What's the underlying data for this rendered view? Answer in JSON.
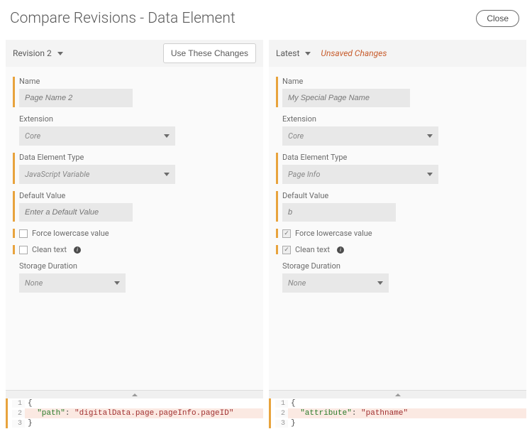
{
  "header": {
    "title": "Compare Revisions - Data Element",
    "close_label": "Close"
  },
  "left": {
    "revision_label": "Revision 2",
    "use_label": "Use These Changes",
    "fields": {
      "name_label": "Name",
      "name_value": "Page Name 2",
      "extension_label": "Extension",
      "extension_value": "Core",
      "type_label": "Data Element Type",
      "type_value": "JavaScript Variable",
      "default_label": "Default Value",
      "default_value": "Enter a Default Value",
      "force_lower_label": "Force lowercase value",
      "force_lower_checked": false,
      "clean_text_label": "Clean text",
      "clean_text_checked": false,
      "storage_label": "Storage Duration",
      "storage_value": "None"
    },
    "code": {
      "line1_open": "{",
      "line2_key": "\"path\"",
      "line2_sep": ": ",
      "line2_val": "\"digitalData.page.pageInfo.pageID\"",
      "line3_close": "}"
    }
  },
  "right": {
    "revision_label": "Latest",
    "unsaved_label": "Unsaved Changes",
    "fields": {
      "name_label": "Name",
      "name_value": "My Special Page Name",
      "extension_label": "Extension",
      "extension_value": "Core",
      "type_label": "Data Element Type",
      "type_value": "Page Info",
      "default_label": "Default Value",
      "default_value": "b",
      "force_lower_label": "Force lowercase value",
      "force_lower_checked": true,
      "clean_text_label": "Clean text",
      "clean_text_checked": true,
      "storage_label": "Storage Duration",
      "storage_value": "None"
    },
    "code": {
      "line1_open": "{",
      "line2_key": "\"attribute\"",
      "line2_sep": ": ",
      "line2_val": "\"pathname\"",
      "line3_close": "}"
    }
  }
}
